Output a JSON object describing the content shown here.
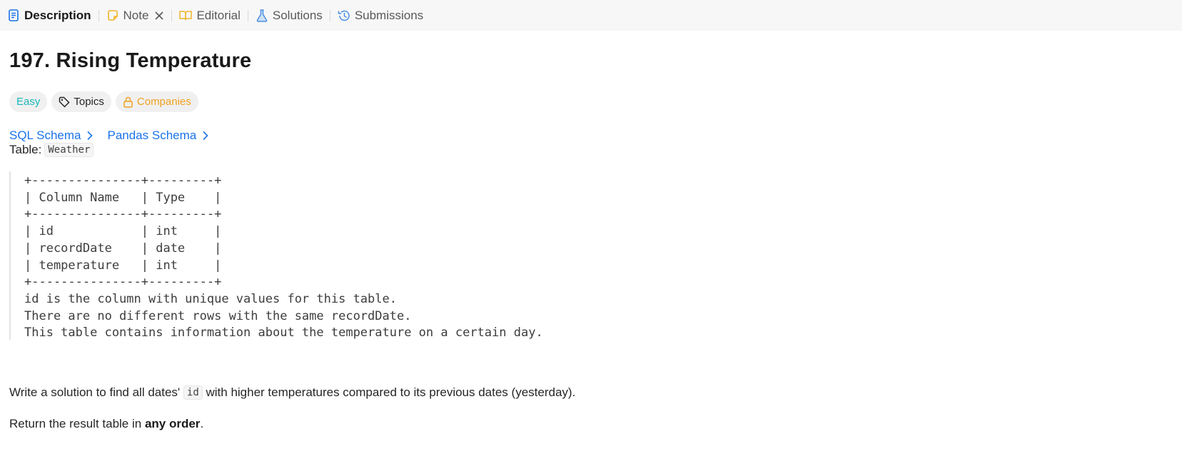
{
  "tabs": [
    {
      "label": "Description",
      "icon": "description-icon",
      "active": true
    },
    {
      "label": "Note",
      "icon": "note-icon",
      "closable": true
    },
    {
      "label": "Editorial",
      "icon": "book-icon"
    },
    {
      "label": "Solutions",
      "icon": "flask-icon"
    },
    {
      "label": "Submissions",
      "icon": "history-icon"
    }
  ],
  "problem": {
    "title": "197. Rising Temperature",
    "tags": {
      "difficulty": "Easy",
      "topics": "Topics",
      "companies": "Companies"
    },
    "schemas": {
      "sql": "SQL Schema",
      "pandas": "Pandas Schema"
    },
    "table_label": "Table: ",
    "table_name": "Weather",
    "schema_text": "+---------------+---------+\n| Column Name   | Type    |\n+---------------+---------+\n| id            | int     |\n| recordDate    | date    |\n| temperature   | int     |\n+---------------+---------+\nid is the column with unique values for this table.\nThere are no different rows with the same recordDate.\nThis table contains information about the temperature on a certain day.",
    "para1_before": "Write a solution to find all dates' ",
    "para1_code": "id",
    "para1_after": " with higher temperatures compared to its previous dates (yesterday).",
    "para2_before": "Return the result table in ",
    "para2_bold": "any order",
    "para2_after": "."
  },
  "colors": {
    "easy": "#1cb8b8",
    "companies": "#f0a020",
    "link": "#1a73e8",
    "description_icon": "#1a73e8",
    "note_icon": "#f0b429",
    "editorial_icon": "#f0b429",
    "solutions_icon": "#4a90e2",
    "submissions_icon": "#4a90e2"
  }
}
